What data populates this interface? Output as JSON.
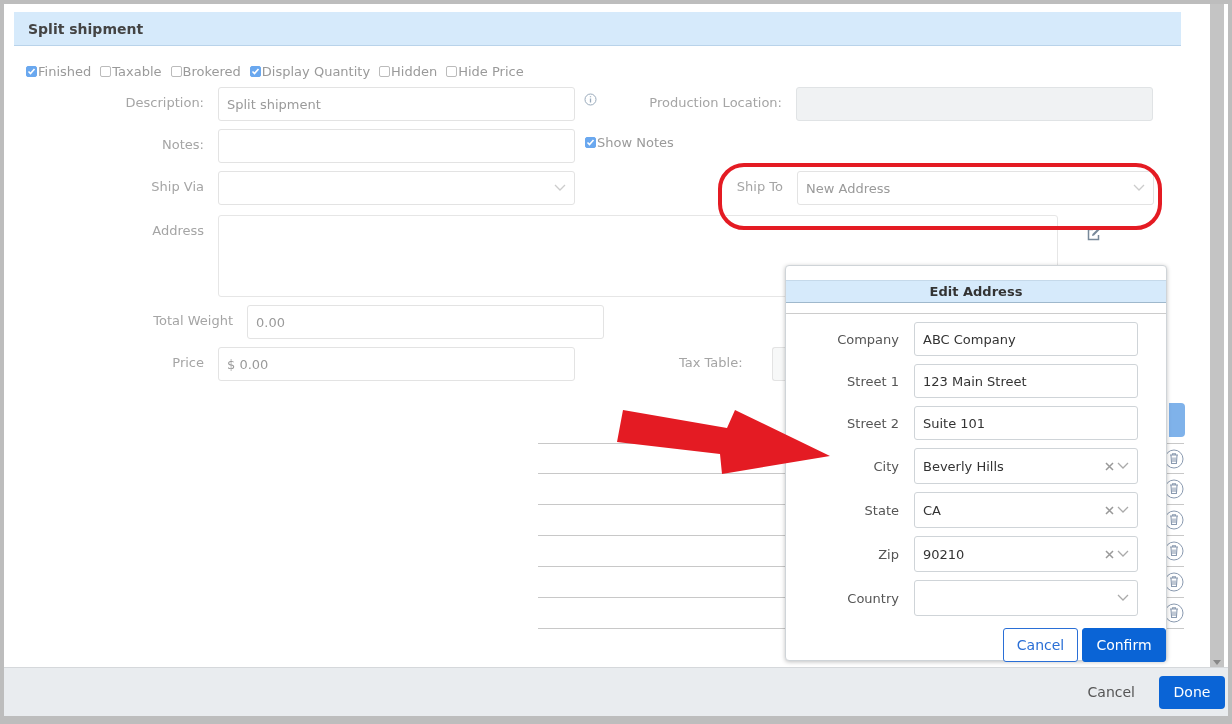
{
  "dialog": {
    "title": "Split shipment",
    "flags": [
      {
        "label": "Finished",
        "checked": true
      },
      {
        "label": "Taxable",
        "checked": false
      },
      {
        "label": "Brokered",
        "checked": false
      },
      {
        "label": "Display Quantity",
        "checked": true
      },
      {
        "label": "Hidden",
        "checked": false
      },
      {
        "label": "Hide Price",
        "checked": false
      }
    ],
    "description": {
      "label": "Description:",
      "value": "Split shipment"
    },
    "production_location": {
      "label": "Production Location:",
      "disabled": true
    },
    "notes": {
      "label": "Notes:"
    },
    "show_notes": {
      "label": "Show Notes",
      "checked": true
    },
    "ship_via": {
      "label": "Ship Via"
    },
    "ship_to": {
      "label": "Ship To",
      "value": "New Address"
    },
    "address": {
      "label": "Address"
    },
    "total_weight": {
      "label": "Total Weight",
      "value": "0.00"
    },
    "price": {
      "label": "Price",
      "value": "$ 0.00"
    },
    "tax_table": {
      "label": "Tax Table:"
    },
    "rows": [
      {
        "kind": "deletable"
      },
      {
        "kind": "deletable"
      },
      {
        "kind": "deletable"
      },
      {
        "kind": "deletable"
      },
      {
        "kind": "deletable"
      },
      {
        "kind": "deletable"
      }
    ],
    "footer_buttons": [
      {
        "label": "Cancel",
        "kind": "secondary"
      },
      {
        "label": "Done",
        "kind": "primary"
      }
    ]
  },
  "edit_address": {
    "title": "Edit Address",
    "fields": [
      {
        "label": "Company",
        "kind": "text",
        "value": "ABC Company"
      },
      {
        "label": "Street 1",
        "kind": "text",
        "value": "123 Main Street"
      },
      {
        "label": "Street 2",
        "kind": "text",
        "value": "Suite 101"
      },
      {
        "label": "City",
        "kind": "select",
        "value": "Beverly Hills",
        "clearable": true
      },
      {
        "label": "State",
        "kind": "select",
        "value": "CA",
        "clearable": true
      },
      {
        "label": "Zip",
        "kind": "select",
        "value": "90210",
        "clearable": true
      },
      {
        "label": "Country",
        "kind": "select",
        "clearable": false
      }
    ],
    "buttons": [
      {
        "label": "Cancel",
        "kind": "secondary"
      },
      {
        "label": "Confirm",
        "kind": "primary"
      }
    ]
  },
  "annotations": [
    {
      "kind": "ellipse"
    },
    {
      "kind": "arrow"
    }
  ]
}
